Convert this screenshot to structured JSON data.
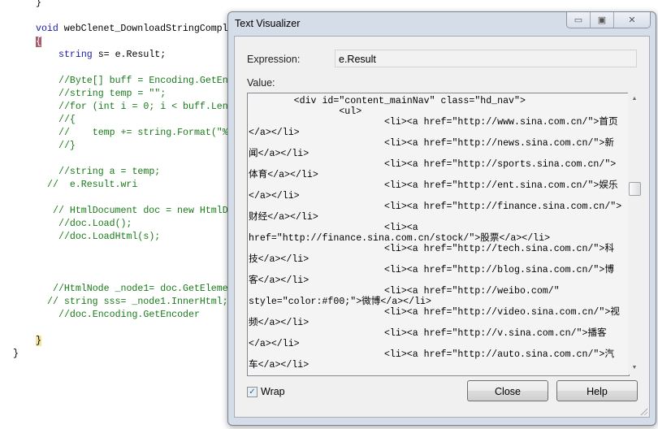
{
  "editor": {
    "lines": [
      "}",
      "void",
      " webClenet_DownloadStringCompl",
      "{",
      "string",
      " s= e.Result;",
      "//Byte[] buff = Encoding.GetEn",
      "//string temp = \"\";",
      "//for (int i = 0; i < buff.Len",
      "//{",
      "//    temp += string.Format(\"%",
      "//}",
      "//string a = temp;",
      "//  e.Result.wri",
      "// HtmlDocument doc = new HtmlD",
      "//doc.Load();",
      "//doc.LoadHtml(s);",
      "//HtmlNode _node1= doc.GetEleme",
      "// string sss= _node1.InnerHtml;",
      "//doc.Encoding.GetEncoder",
      "}",
      "}"
    ]
  },
  "dialog": {
    "title": "Text Visualizer",
    "expression_label": "Expression:",
    "expression_value": "e.Result",
    "value_label": "Value:",
    "value_lines": [
      "        <div id=\"content_mainNav\" class=\"hd_nav\">",
      "                <ul>",
      "                        <li><a href=\"http://www.sina.com.cn/\">首页",
      "</a></li>",
      "                        <li><a href=\"http://news.sina.com.cn/\">新",
      "闻</a></li>",
      "                        <li><a href=\"http://sports.sina.com.cn/\">",
      "体育</a></li>",
      "                        <li><a href=\"http://ent.sina.com.cn/\">娱乐",
      "</a></li>",
      "                        <li><a href=\"http://finance.sina.com.cn/\">",
      "财经</a></li>",
      "                        <li><a",
      "href=\"http://finance.sina.com.cn/stock/\">股票</a></li>",
      "                        <li><a href=\"http://tech.sina.com.cn/\">科",
      "技</a></li>",
      "                        <li><a href=\"http://blog.sina.com.cn/\">博",
      "客</a></li>",
      "                        <li><a href=\"http://weibo.com/\"",
      "style=\"color:#f00;\">微博</a></li>",
      "                        <li><a href=\"http://video.sina.com.cn/\">视",
      "频</a></li>",
      "                        <li><a href=\"http://v.sina.com.cn/\">播客",
      "</a></li>",
      "                        <li><a href=\"http://auto.sina.com.cn/\">汽",
      "车</a></li>"
    ],
    "wrap_label": "Wrap",
    "wrap_checked": true,
    "close_label": "Close",
    "help_label": "Help",
    "window_controls": {
      "minimize": "▭",
      "maximize": "▣",
      "close": "✕"
    }
  }
}
